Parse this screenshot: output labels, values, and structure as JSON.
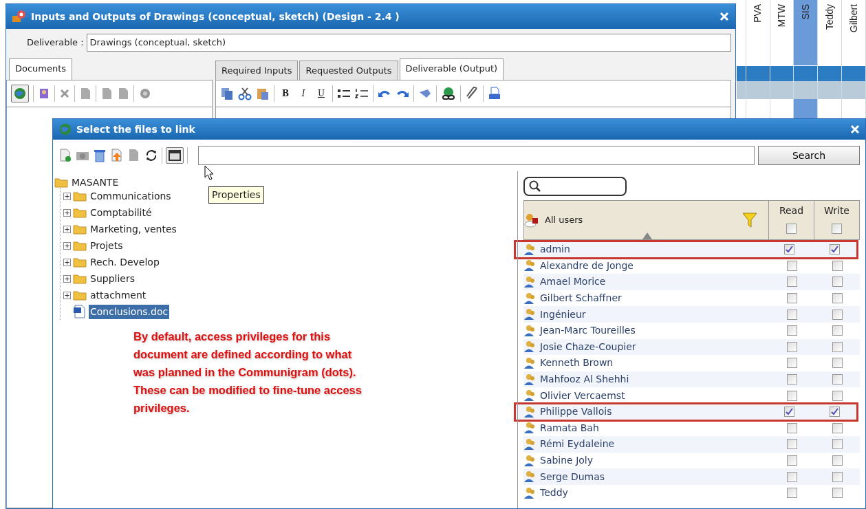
{
  "window": {
    "title": "Inputs and Outputs of Drawings (conceptual, sketch) (Design - 2.4 )"
  },
  "deliverable": {
    "label": "Deliverable :",
    "value": "Drawings (conceptual, sketch)"
  },
  "left_tabs": [
    {
      "label": "Documents",
      "selected": true
    }
  ],
  "right_tabs": [
    {
      "label": "Required Inputs",
      "selected": false
    },
    {
      "label": "Requested Outputs",
      "selected": false
    },
    {
      "label": "Deliverable (Output)",
      "selected": true
    }
  ],
  "format_buttons": [
    "B",
    "I",
    "U"
  ],
  "grid_columns": [
    {
      "label": "PVA",
      "selected": false
    },
    {
      "label": "MTW",
      "selected": false
    },
    {
      "label": "SIS",
      "selected": true
    },
    {
      "label": "Teddy",
      "selected": false
    },
    {
      "label": "Gilbert",
      "selected": false
    }
  ],
  "dialog": {
    "title": "Select the files to link",
    "search_button": "Search",
    "tooltip": "Properties",
    "tree": {
      "label": "MASANTE",
      "children": [
        {
          "label": "Communications",
          "kind": "folder",
          "expanded": false,
          "selected": false
        },
        {
          "label": "Comptabilité",
          "kind": "folder",
          "expanded": false,
          "selected": false
        },
        {
          "label": "Marketing, ventes",
          "kind": "folder",
          "expanded": false,
          "selected": false
        },
        {
          "label": "Projets",
          "kind": "folder",
          "expanded": false,
          "selected": false
        },
        {
          "label": "Rech. Develop",
          "kind": "folder",
          "expanded": false,
          "selected": false
        },
        {
          "label": "Suppliers",
          "kind": "folder",
          "expanded": false,
          "selected": false
        },
        {
          "label": "attachment",
          "kind": "folder",
          "expanded": false,
          "selected": false
        },
        {
          "label": "Conclusions.doc",
          "kind": "file",
          "selected": true
        }
      ]
    },
    "users_table": {
      "columns": [
        {
          "label": "All users"
        },
        {
          "label": "Read",
          "checked": false
        },
        {
          "label": "Write",
          "checked": false
        }
      ],
      "rows": [
        {
          "name": "admin",
          "read": true,
          "write": true,
          "highlighted": true
        },
        {
          "name": "Alexandre de Jonge",
          "read": false,
          "write": false,
          "highlighted": false
        },
        {
          "name": "Amael Morice",
          "read": false,
          "write": false,
          "highlighted": false
        },
        {
          "name": "Gilbert Schaffner",
          "read": false,
          "write": false,
          "highlighted": false
        },
        {
          "name": "Ingénieur",
          "read": false,
          "write": false,
          "highlighted": false
        },
        {
          "name": "Jean-Marc Toureilles",
          "read": false,
          "write": false,
          "highlighted": false
        },
        {
          "name": "Josie Chaze-Coupier",
          "read": false,
          "write": false,
          "highlighted": false
        },
        {
          "name": "Kenneth Brown",
          "read": false,
          "write": false,
          "highlighted": false
        },
        {
          "name": "Mahfooz Al Shehhi",
          "read": false,
          "write": false,
          "highlighted": false
        },
        {
          "name": "Olivier Vercaemst",
          "read": false,
          "write": false,
          "highlighted": false
        },
        {
          "name": "Philippe Vallois",
          "read": true,
          "write": true,
          "highlighted": true
        },
        {
          "name": "Ramata Bah",
          "read": false,
          "write": false,
          "highlighted": false
        },
        {
          "name": "Rémi Eydaleine",
          "read": false,
          "write": false,
          "highlighted": false
        },
        {
          "name": "Sabine Joly",
          "read": false,
          "write": false,
          "highlighted": false
        },
        {
          "name": "Serge Dumas",
          "read": false,
          "write": false,
          "highlighted": false
        },
        {
          "name": "Teddy",
          "read": false,
          "write": false,
          "highlighted": false
        }
      ]
    }
  },
  "annotation": [
    "By default, access privileges for this document are defined according to what was planned in the Communigram (dots).",
    "These can be modified to fine-tune access privileges."
  ]
}
